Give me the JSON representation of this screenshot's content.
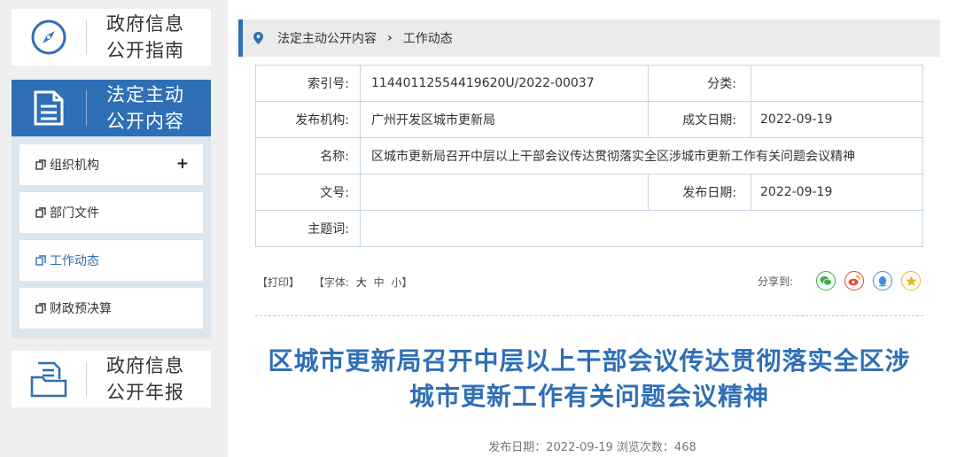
{
  "sidebar": {
    "guide": {
      "line1": "政府信息",
      "line2": "公开指南"
    },
    "statutory": {
      "line1": "法定主动",
      "line2": "公开内容"
    },
    "items": [
      {
        "label": "组织机构",
        "expand": "+"
      },
      {
        "label": "部门文件"
      },
      {
        "label": "工作动态"
      },
      {
        "label": "财政预决算"
      }
    ],
    "annual": {
      "line1": "政府信息",
      "line2": "公开年报"
    }
  },
  "breadcrumb": {
    "level1": "法定主动公开内容",
    "sep": "›",
    "level2": "工作动态"
  },
  "info": {
    "index_label": "索引号:",
    "index_value": "11440112554419620U/2022-00037",
    "category_label": "分类:",
    "category_value": "",
    "publisher_label": "发布机构:",
    "publisher_value": "广州开发区城市更新局",
    "doc_date_label": "成文日期:",
    "doc_date_value": "2022-09-19",
    "name_label": "名称:",
    "name_value": "区城市更新局召开中层以上干部会议传达贯彻落实全区涉城市更新工作有关问题会议精神",
    "docno_label": "文号:",
    "docno_value": "",
    "pub_date_label": "发布日期:",
    "pub_date_value": "2022-09-19",
    "keywords_label": "主题词:",
    "keywords_value": ""
  },
  "tools": {
    "print": "【打印】",
    "font_label": "【字体:",
    "font_large": "大",
    "font_medium": "中",
    "font_small": "小】"
  },
  "share": {
    "label": "分享到:"
  },
  "article": {
    "title_line1": "区城市更新局召开中层以上干部会议传达贯彻落实全区涉",
    "title_line2": "城市更新工作有关问题会议精神",
    "meta": "发布日期：2022-09-19  浏览次数：468"
  },
  "colors": {
    "accent": "#2f6fb6",
    "wechat": "#3aae4a",
    "weibo": "#e6462e",
    "qq": "#3e8fd8",
    "qzone": "#f2b31b"
  }
}
